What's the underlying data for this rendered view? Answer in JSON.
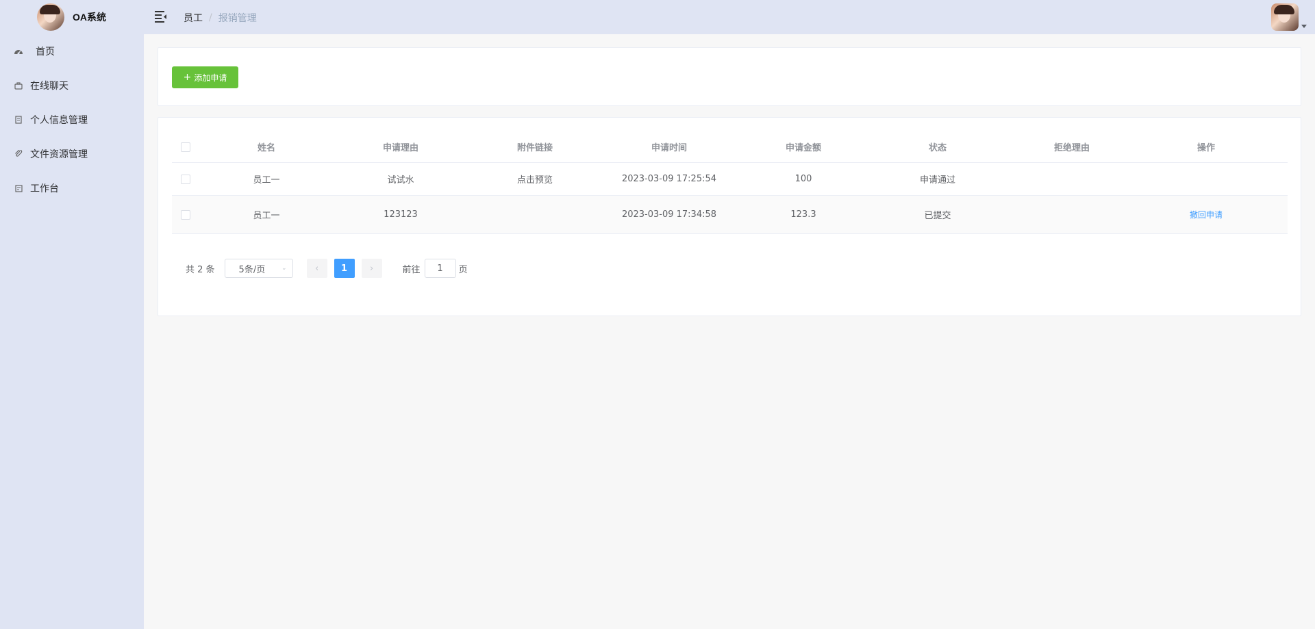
{
  "app": {
    "title": "OA系统"
  },
  "breadcrumb": {
    "parent": "员工",
    "separator": "/",
    "current": "报销管理"
  },
  "sidebar": {
    "items": [
      {
        "label": "首页",
        "icon": "dashboard-icon"
      },
      {
        "label": "在线聊天",
        "icon": "briefcase-icon"
      },
      {
        "label": "个人信息管理",
        "icon": "document-icon"
      },
      {
        "label": "文件资源管理",
        "icon": "paperclip-icon"
      },
      {
        "label": "工作台",
        "icon": "calendar-icon"
      }
    ]
  },
  "toolbar": {
    "add_label": "添加申请"
  },
  "table": {
    "headers": [
      "姓名",
      "申请理由",
      "附件链接",
      "申请时间",
      "申请金额",
      "状态",
      "拒绝理由",
      "操作"
    ],
    "rows": [
      {
        "name": "员工一",
        "reason": "试试水",
        "attachment": "点击预览",
        "time": "2023-03-09 17:25:54",
        "amount": "100",
        "status": "申请通过",
        "reject_reason": "",
        "action": ""
      },
      {
        "name": "员工一",
        "reason": "123123",
        "attachment": "",
        "time": "2023-03-09 17:34:58",
        "amount": "123.3",
        "status": "已提交",
        "reject_reason": "",
        "action": "撤回申请"
      }
    ]
  },
  "pagination": {
    "total_label": "共 2 条",
    "page_size": "5条/页",
    "current_page": "1",
    "goto_prefix": "前往",
    "goto_value": "1",
    "goto_suffix": "页"
  },
  "colors": {
    "primary": "#409eff",
    "success": "#67c23a",
    "sidebar_bg": "#dfe4f3"
  }
}
